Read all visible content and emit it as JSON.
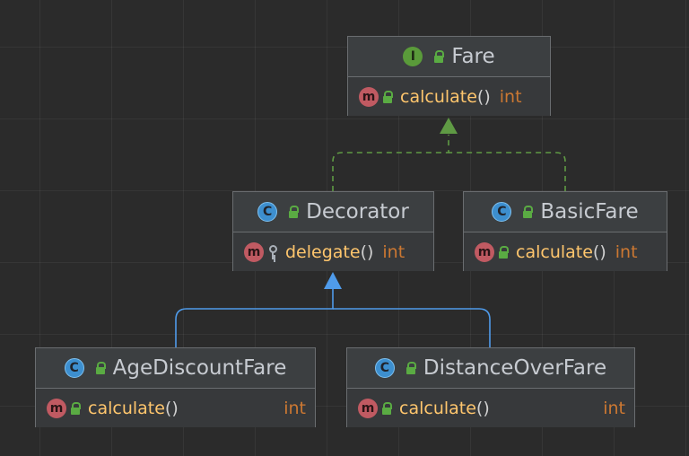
{
  "diagram": {
    "nodes": [
      {
        "id": "fare",
        "kind": "interface",
        "badge": "I",
        "name": "Fare",
        "member": {
          "badge": "m",
          "name": "calculate",
          "parens": "()",
          "type": "int"
        }
      },
      {
        "id": "decorator",
        "kind": "class",
        "badge": "C",
        "name": "Decorator",
        "member": {
          "badge": "m",
          "name": "delegate",
          "parens": "()",
          "type": "int"
        }
      },
      {
        "id": "basic",
        "kind": "class",
        "badge": "C",
        "name": "BasicFare",
        "member": {
          "badge": "m",
          "name": "calculate",
          "parens": "()",
          "type": "int"
        }
      },
      {
        "id": "age",
        "kind": "class",
        "badge": "C",
        "name": "AgeDiscountFare",
        "member": {
          "badge": "m",
          "name": "calculate",
          "parens": "()",
          "type": "int"
        }
      },
      {
        "id": "distance",
        "kind": "class",
        "badge": "C",
        "name": "DistanceOverFare",
        "member": {
          "badge": "m",
          "name": "calculate",
          "parens": "()",
          "type": "int"
        }
      }
    ],
    "edges": [
      {
        "from": "decorator",
        "to": "fare",
        "relation": "implements"
      },
      {
        "from": "basic",
        "to": "fare",
        "relation": "implements"
      },
      {
        "from": "age",
        "to": "decorator",
        "relation": "extends"
      },
      {
        "from": "distance",
        "to": "decorator",
        "relation": "extends"
      }
    ],
    "colors": {
      "implements": "#5f9a44",
      "extends": "#4f9bea",
      "icon_class": "#3d8fcf",
      "icon_interface": "#5a9b3a",
      "icon_method": "#c05a62",
      "method_name": "#ffc66d",
      "type": "#cc7832"
    }
  }
}
